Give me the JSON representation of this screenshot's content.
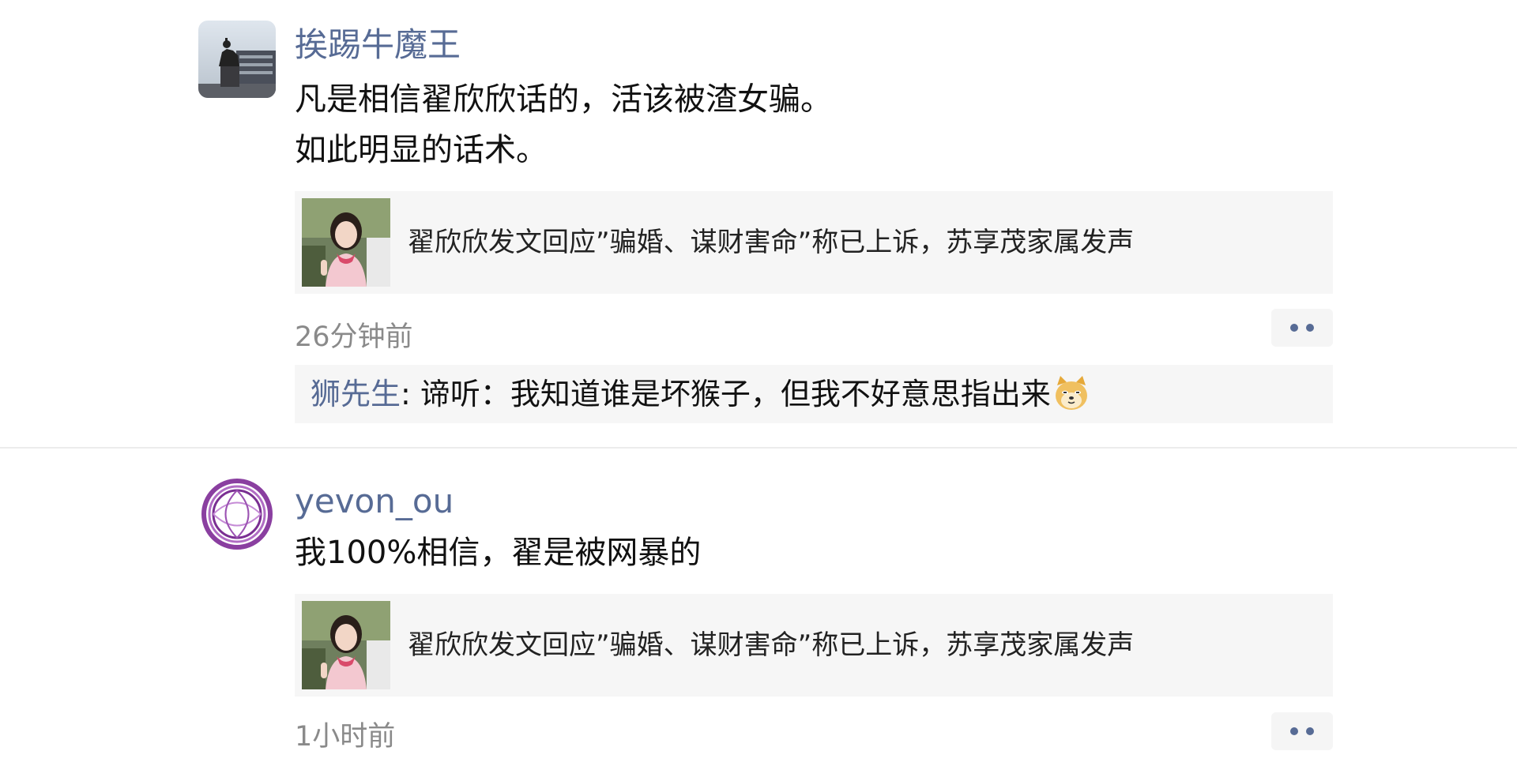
{
  "posts": [
    {
      "username": "挨踢牛魔王",
      "content_lines": [
        "凡是相信翟欣欣话的，活该被渣女骗。",
        "如此明显的话术。"
      ],
      "link": {
        "title": "翟欣欣发文回应”骗婚、谋财害命”称已上诉，苏享茂家属发声",
        "thumb_icon": "woman-photo-thumbnail"
      },
      "timestamp": "26分钟前",
      "avatar_icon": "statue-photo-avatar",
      "comments": [
        {
          "author": "狮先生",
          "separator": ":",
          "text": " 谛听：我知道谁是坏猴子，但我不好意思指出来",
          "emoji": "doge-emoji"
        }
      ]
    },
    {
      "username": "yevon_ou",
      "content_lines": [
        "我100%相信，翟是被网暴的"
      ],
      "link": {
        "title": "翟欣欣发文回应”骗婚、谋财害命”称已上诉，苏享茂家属发声",
        "thumb_icon": "woman-photo-thumbnail"
      },
      "timestamp": "1小时前",
      "avatar_icon": "purple-ring-logo-avatar"
    }
  ],
  "colors": {
    "name_link": "#576b95",
    "text": "#111111",
    "muted": "#8a8a8a",
    "card_bg": "#f6f6f6"
  }
}
